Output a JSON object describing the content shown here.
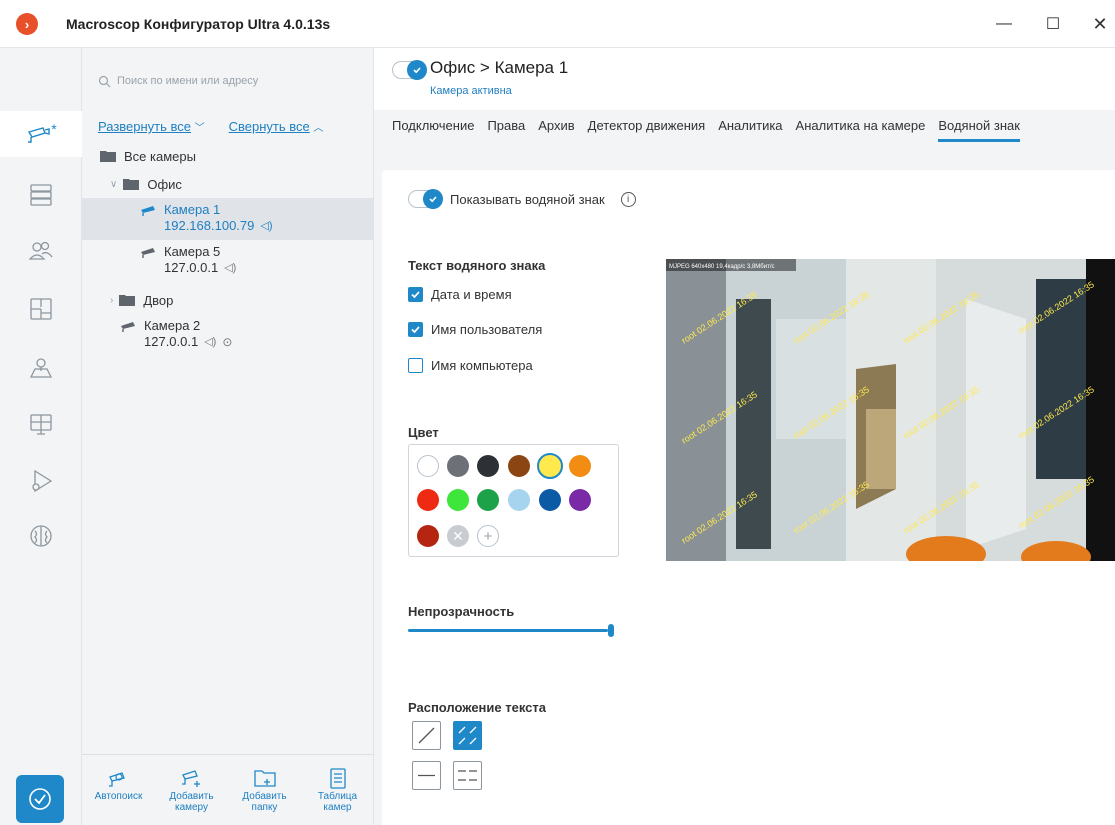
{
  "window": {
    "title": "Macroscop Конфигуратор Ultra 4.0.13s",
    "logo_glyph": "›",
    "minimize": "—",
    "maximize": "☐",
    "close": "✕"
  },
  "rail": {
    "items": [
      {
        "name": "cameras",
        "icon": "camera-icon",
        "active": true
      },
      {
        "name": "servers",
        "icon": "server-icon"
      },
      {
        "name": "users",
        "icon": "users-icon"
      },
      {
        "name": "layouts",
        "icon": "layout-icon"
      },
      {
        "name": "maps",
        "icon": "map-icon"
      },
      {
        "name": "monitors",
        "icon": "monitor-icon"
      },
      {
        "name": "scenarios",
        "icon": "play-gear-icon"
      },
      {
        "name": "analytics",
        "icon": "brain-icon"
      }
    ],
    "camera_modified_marker": "*"
  },
  "tree_panel": {
    "search_placeholder": "Поиск по имени или адресу",
    "expand_all": "Развернуть все",
    "collapse_all": "Свернуть все",
    "root": "Все камеры",
    "folders": [
      {
        "name": "Офис",
        "expanded": true,
        "cameras": [
          {
            "name": "Камера 1",
            "ip": "192.168.100.79",
            "selected": true
          },
          {
            "name": "Камера 5",
            "ip": "127.0.0.1"
          }
        ]
      },
      {
        "name": "Двор",
        "expanded": false
      }
    ],
    "loose_cameras": [
      {
        "name": "Камера 2",
        "ip": "127.0.0.1"
      }
    ],
    "toolbar": {
      "autosearch": "Автопоиск",
      "add_camera_1": "Добавить",
      "add_camera_2": "камеру",
      "add_folder_1": "Добавить",
      "add_folder_2": "папку",
      "camera_table_1": "Таблица",
      "camera_table_2": "камер"
    }
  },
  "header": {
    "title": "Офис > Камера 1",
    "subtitle": "Камера активна"
  },
  "tabs": [
    "Подключение",
    "Права",
    "Архив",
    "Детектор движения",
    "Аналитика",
    "Аналитика на камере",
    "Водяной знак"
  ],
  "active_tab": "Водяной знак",
  "watermark": {
    "show_label": "Показывать водяной знак",
    "info_glyph": "i",
    "text_section": "Текст водяного знака",
    "options": [
      {
        "label": "Дата и время",
        "checked": true
      },
      {
        "label": "Имя пользователя",
        "checked": true
      },
      {
        "label": "Имя компьютера",
        "checked": false
      }
    ],
    "color_section": "Цвет",
    "colors": [
      "#ffffff",
      "#6d7177",
      "#2d3136",
      "#8b4513",
      "#ffe94d",
      "#f28c13",
      "#ee2b12",
      "#3ee53a",
      "#1da24a",
      "#a6d4ee",
      "#0a5aa6",
      "#7a2aa6",
      "#b5250f"
    ],
    "selected_color": "#ffe94d",
    "opacity_section": "Непрозрачность",
    "opacity_value": 1.0,
    "position_section": "Расположение текста",
    "preview": {
      "stream_info": "MJPEG 640x480 19,4кадр/с 3,8Мбит/с",
      "watermark_text": "root 02.06.2022 16:35"
    }
  }
}
